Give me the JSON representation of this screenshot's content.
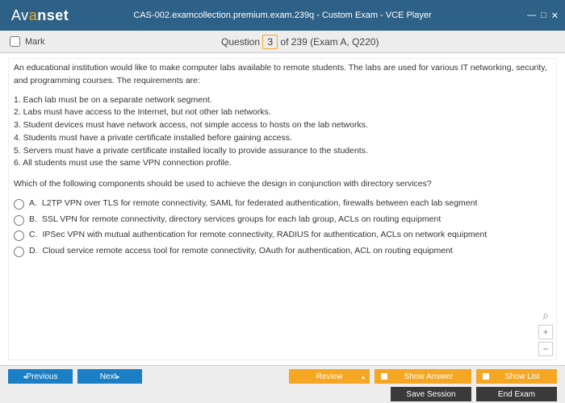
{
  "window": {
    "title": "CAS-002.examcollection.premium.exam.239q - Custom Exam - VCE Player",
    "brand_pre": "Av",
    "brand_accent": "a",
    "brand_post": "nset"
  },
  "infobar": {
    "mark": "Mark",
    "question_pre": "Question",
    "question_num": "3",
    "question_post": " of 239 (Exam A, Q220)"
  },
  "question": {
    "intro": "An educational institution would like to make computer labs available to remote students. The labs are used for various IT networking, security, and programming courses. The requirements are:",
    "reqs": [
      "1. Each lab must be on a separate network segment.",
      "2. Labs must have access to the Internet, but not other lab networks.",
      "3. Student devices must have network access, not simple access to hosts on the lab networks.",
      "4. Students must have a private certificate installed before gaining access.",
      "5. Servers must have a private certificate installed locally to provide assurance to the students.",
      "6. All students must use the same VPN connection profile."
    ],
    "prompt": "Which of the following components should be used to achieve the design in conjunction with directory services?"
  },
  "options": [
    {
      "letter": "A.",
      "text": "L2TP VPN over TLS for remote connectivity, SAML for federated authentication, firewalls between each lab segment"
    },
    {
      "letter": "B.",
      "text": "SSL VPN for remote connectivity, directory services groups for each lab group, ACLs on routing equipment"
    },
    {
      "letter": "C.",
      "text": "IPSec VPN with mutual authentication for remote connectivity, RADIUS for authentication, ACLs on network equipment"
    },
    {
      "letter": "D.",
      "text": "Cloud service remote access tool for remote connectivity, OAuth for authentication, ACL on routing equipment"
    }
  ],
  "zoom": {
    "plus": "+",
    "minus": "−",
    "mag": "⌕"
  },
  "buttons": {
    "previous": "Previous",
    "next": "Next",
    "review": "Review",
    "show_answer": "Show Answer",
    "show_list": "Show List",
    "save_session": "Save Session",
    "end_exam": "End Exam"
  }
}
